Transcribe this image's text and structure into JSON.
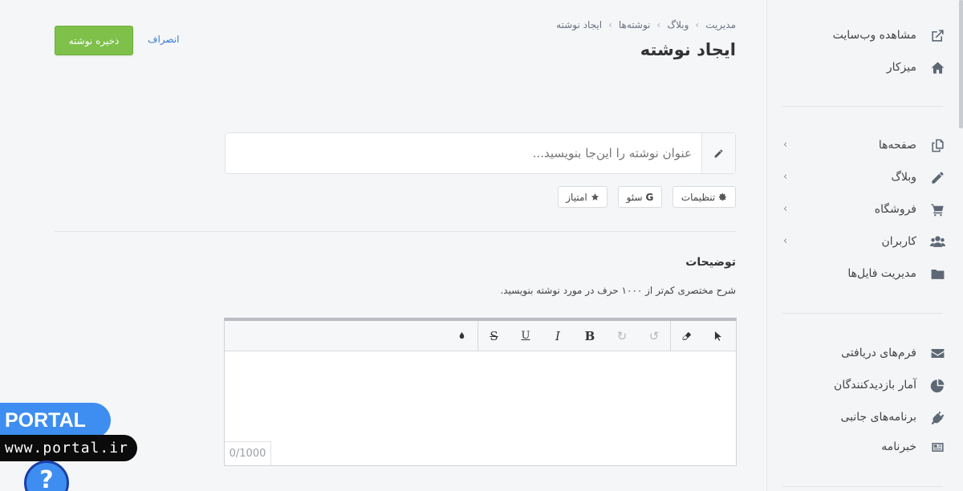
{
  "header": {
    "breadcrumb": [
      "مدیریت",
      "وبلاگ",
      "نوشته‌ها",
      "ایجاد نوشته"
    ],
    "title": "ایجاد نوشته",
    "save_label": "ذخیره نوشته",
    "cancel_label": "انصراف"
  },
  "sidebar": {
    "top_items": [
      {
        "label": "مشاهده وب‌سایت",
        "icon": "external-link-icon"
      },
      {
        "label": "میزکار",
        "icon": "home-icon"
      }
    ],
    "main_items": [
      {
        "label": "صفحه‌ها",
        "icon": "pages-icon",
        "has_submenu": true
      },
      {
        "label": "وبلاگ",
        "icon": "pencil-icon",
        "has_submenu": true
      },
      {
        "label": "فروشگاه",
        "icon": "cart-icon",
        "has_submenu": true
      },
      {
        "label": "کاربران",
        "icon": "users-icon",
        "has_submenu": true
      },
      {
        "label": "مدیریت فایل‌ها",
        "icon": "folder-icon",
        "has_submenu": false
      }
    ],
    "bottom_items": [
      {
        "label": "فرم‌های دریافتی",
        "icon": "envelope-icon"
      },
      {
        "label": "آمار بازدیدکنندگان",
        "icon": "pie-chart-icon"
      },
      {
        "label": "برنامه‌های جانبی",
        "icon": "plug-icon"
      },
      {
        "label": "خبرنامه",
        "icon": "newspaper-icon"
      }
    ]
  },
  "post": {
    "title_placeholder": "عنوان نوشته را این‌جا بنویسید...",
    "title_value": "",
    "options": [
      {
        "label": "تنظیمات",
        "icon": "gear-icon"
      },
      {
        "label": "سئو",
        "icon": "google-icon",
        "glyph": "G"
      },
      {
        "label": "امتیاز",
        "icon": "star-icon"
      }
    ]
  },
  "description": {
    "title": "توضیحات",
    "hint": "شرح مختصری کم‌تر از ۱۰۰۰ حرف در مورد نوشته بنویسید.",
    "counter": "0/1000",
    "toolbar": [
      {
        "name": "cursor-icon",
        "text": ""
      },
      {
        "name": "eraser-icon",
        "text": ""
      },
      {
        "name": "undo-icon",
        "text": "↺"
      },
      {
        "name": "redo-icon",
        "text": "↻"
      },
      {
        "name": "bold-icon",
        "text": "B"
      },
      {
        "name": "italic-icon",
        "text": "I"
      },
      {
        "name": "underline-icon",
        "text": "U"
      },
      {
        "name": "strikethrough-icon",
        "text": "S"
      },
      {
        "name": "text-color-icon",
        "text": ""
      }
    ]
  },
  "watermark": {
    "brand": "PORTAL",
    "url": "www.portal.ir",
    "help": "?"
  }
}
